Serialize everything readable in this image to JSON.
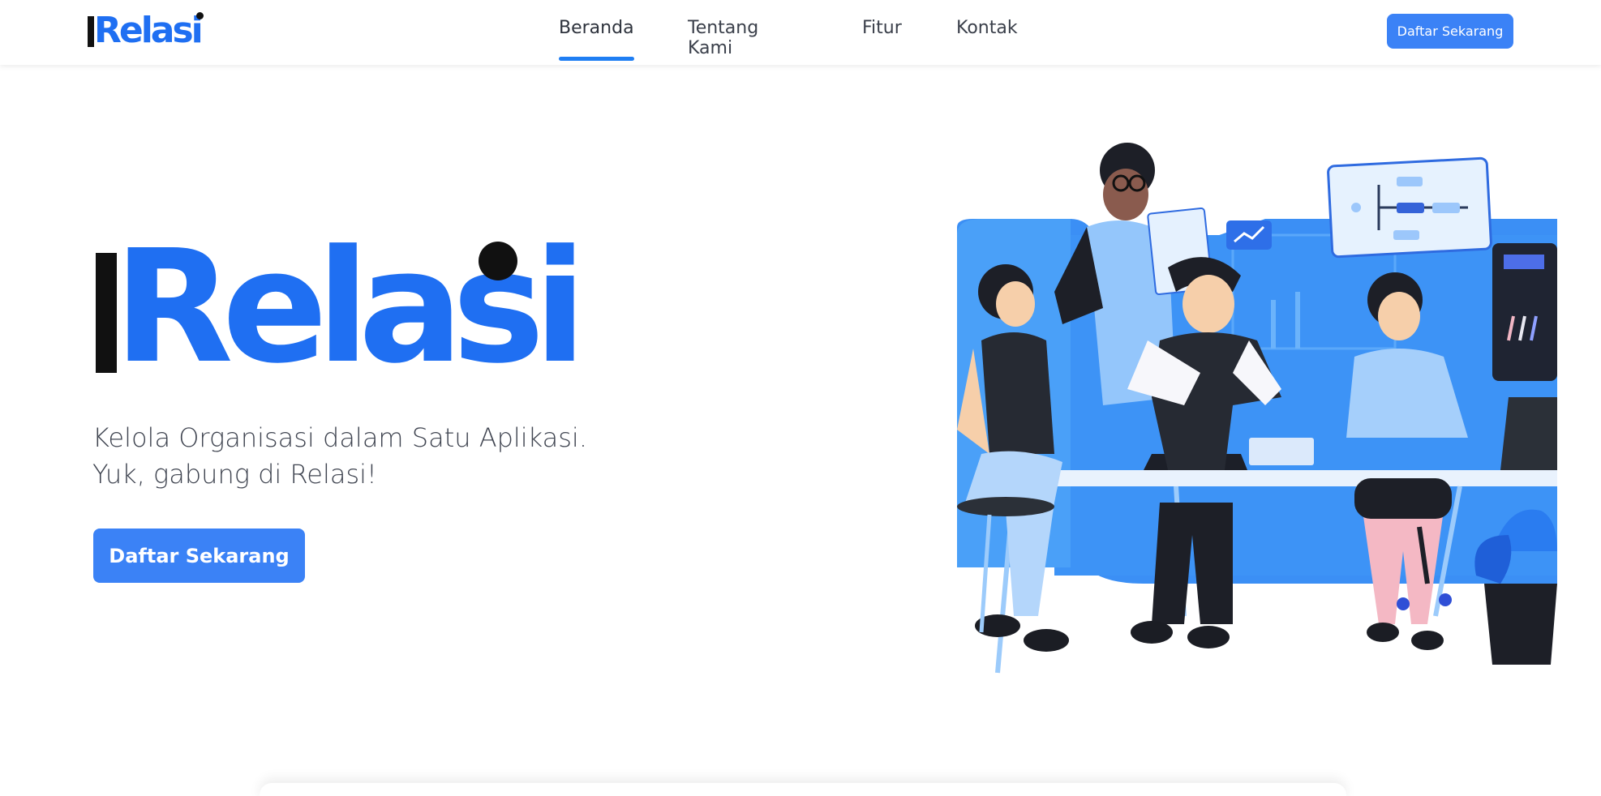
{
  "brand": {
    "logo_text": "Relasi",
    "colors": {
      "brand_blue": "#1f6ff2",
      "accent_button": "#3b82f6",
      "active_underline": "#1f7ef3"
    }
  },
  "nav": {
    "items": [
      {
        "label": "Beranda",
        "active": true
      },
      {
        "label": "Tentang Kami",
        "active": false
      },
      {
        "label": "Fitur",
        "active": false
      },
      {
        "label": "Kontak",
        "active": false
      }
    ]
  },
  "header": {
    "cta_label": "Daftar Sekarang"
  },
  "hero": {
    "logo_text": "Relasi",
    "tagline_line1": "Kelola Organisasi dalam Satu Aplikasi.",
    "tagline_line2": "Yuk, gabung di Relasi!",
    "cta_label": "Daftar Sekarang"
  }
}
